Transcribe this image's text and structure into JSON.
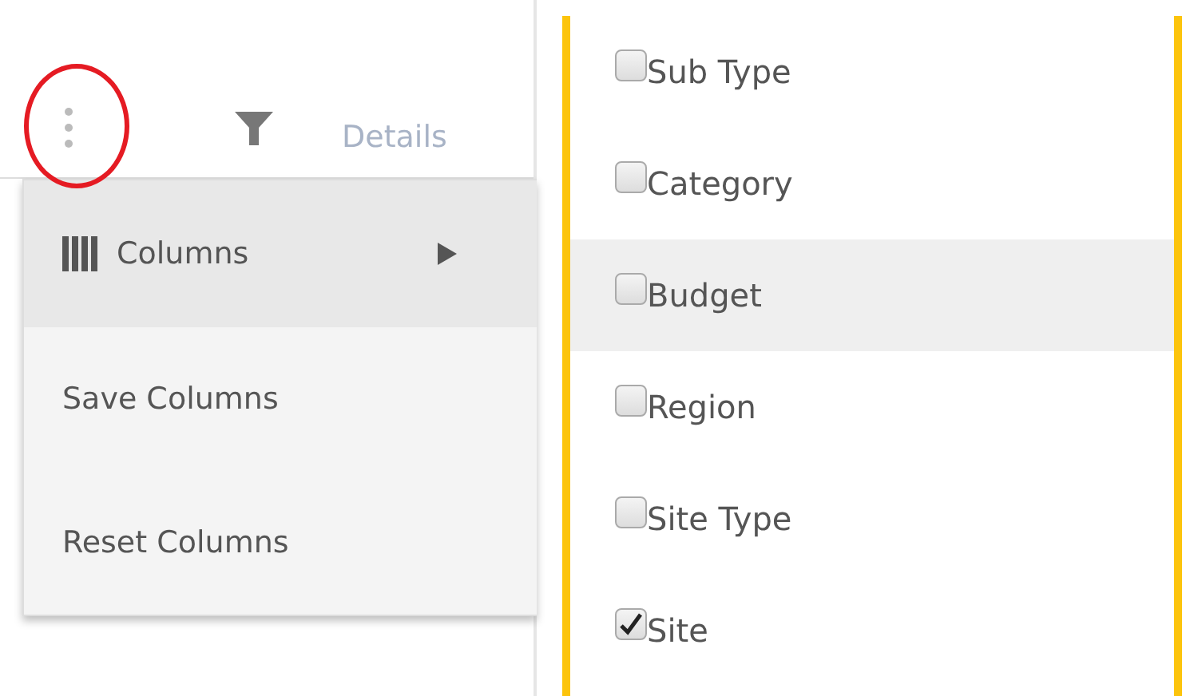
{
  "toolbar": {
    "details_label": "Details"
  },
  "menu": {
    "items": [
      {
        "kind": "submenu",
        "label": "Columns",
        "highlighted": true
      },
      {
        "kind": "action",
        "label": "Save Columns",
        "highlighted": false
      },
      {
        "kind": "action",
        "label": "Reset Columns",
        "highlighted": false
      }
    ]
  },
  "column_list": {
    "items": [
      {
        "label": "Sub Type",
        "checked": false,
        "highlighted": false
      },
      {
        "label": "Category",
        "checked": false,
        "highlighted": false
      },
      {
        "label": "Budget",
        "checked": false,
        "highlighted": true
      },
      {
        "label": "Region",
        "checked": false,
        "highlighted": false
      },
      {
        "label": "Site Type",
        "checked": false,
        "highlighted": false
      },
      {
        "label": "Site",
        "checked": true,
        "highlighted": false
      }
    ]
  }
}
